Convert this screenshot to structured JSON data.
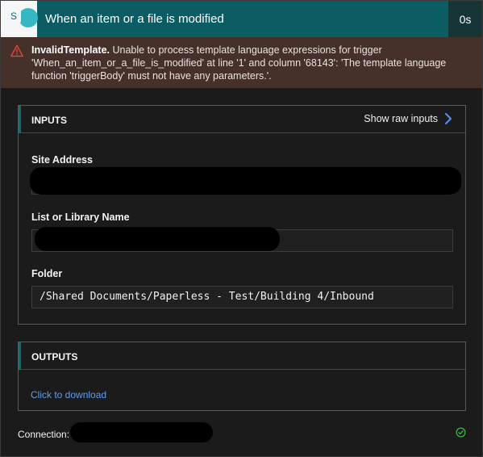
{
  "header": {
    "app_initial": "S",
    "title": "When an item or a file is modified",
    "duration": "0s",
    "accent_color": "#0b5d63"
  },
  "error": {
    "code": "InvalidTemplate.",
    "message": "Unable to process template language expressions for trigger 'When_an_item_or_a_file_is_modified' at line '1' and column '68143': 'The template language function 'triggerBody' must not have any parameters.'.",
    "icon": "warning-triangle-icon",
    "color": "#e2483a"
  },
  "inputs": {
    "section_label": "INPUTS",
    "show_raw_label": "Show raw inputs",
    "fields": {
      "site_address_label": "Site Address",
      "site_address_value": "",
      "list_name_label": "List or Library Name",
      "list_name_value": "",
      "folder_label": "Folder",
      "folder_value": "/Shared Documents/Paperless - Test/Building 4/Inbound"
    }
  },
  "outputs": {
    "section_label": "OUTPUTS",
    "download_label": "Click to download",
    "link_color": "#5d9cf2"
  },
  "footer": {
    "connection_label": "Connection:",
    "connection_value": "",
    "status_icon": "check-circle-icon",
    "status_color": "#3fb950"
  }
}
